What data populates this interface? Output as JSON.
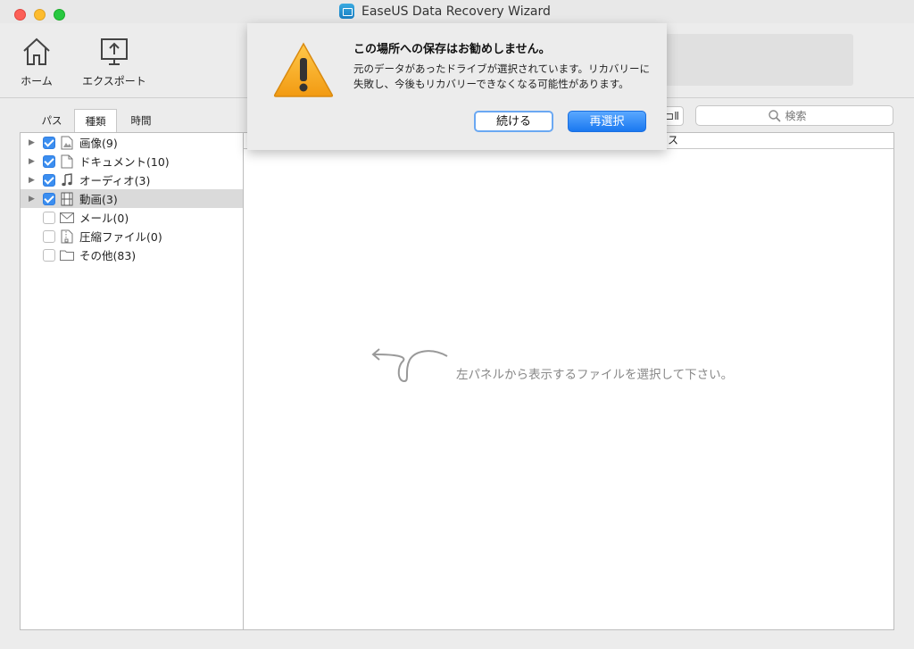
{
  "window": {
    "title": "EaseUS Data Recovery Wizard"
  },
  "toolbar": {
    "home_label": "ホーム",
    "export_label": "エクスポート"
  },
  "left_tabs": [
    "パス",
    "種類",
    "時間"
  ],
  "tree": [
    {
      "label": "画像(9)",
      "checked": true,
      "expandable": true,
      "icon": "image-file-icon"
    },
    {
      "label": "ドキュメント(10)",
      "checked": true,
      "expandable": true,
      "icon": "document-icon"
    },
    {
      "label": "オーディオ(3)",
      "checked": true,
      "expandable": true,
      "icon": "music-note-icon"
    },
    {
      "label": "動画(3)",
      "checked": true,
      "expandable": true,
      "icon": "film-icon",
      "selected": true
    },
    {
      "label": "メール(0)",
      "checked": false,
      "expandable": false,
      "icon": "mail-icon"
    },
    {
      "label": "圧縮ファイル(0)",
      "checked": false,
      "expandable": false,
      "icon": "zip-file-icon"
    },
    {
      "label": "その他(83)",
      "checked": false,
      "expandable": false,
      "icon": "folder-icon"
    }
  ],
  "right": {
    "view_button_label": "⊐Ⅱ",
    "search_placeholder": "検索",
    "column_header": "ス",
    "empty_hint": "左パネルから表示するファイルを選択して下さい。"
  },
  "alert": {
    "title": "この場所への保存はお勧めしません。",
    "message": "元のデータがあったドライブが選択されています。リカバリーに失敗し、今後もリカバリーできなくなる可能性があります。",
    "continue_label": "続ける",
    "reselect_label": "再選択"
  },
  "colors": {
    "accent": "#1a78f0",
    "checkbox": "#3b8ef0",
    "warning": "#f5a623"
  }
}
